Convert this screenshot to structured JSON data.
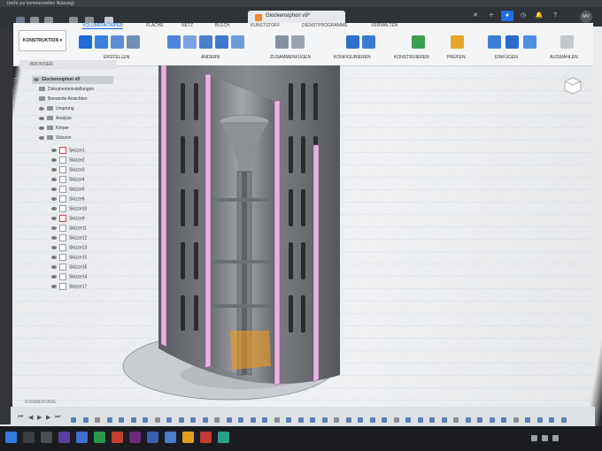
{
  "title_bar": {
    "text": "(nicht zur kommerziellen Nutzung)"
  },
  "document": {
    "name": "Glockensiphon v9*"
  },
  "user": {
    "initials": "MV"
  },
  "ribbon": {
    "mode": "KONSTRUKTION",
    "tabs": [
      "VOLUMENKÖRPER",
      "FLÄCHE",
      "NETZ",
      "BLECH",
      "KUNSTSTOFF",
      "DIENSTPROGRAMME",
      "VERWALTEN"
    ],
    "groups": [
      "ERSTELLEN",
      "ÄNDERN",
      "ZUSAMMENFÜGEN",
      "KONFIGURIEREN",
      "KONSTRUIEREN",
      "PRÜFEN",
      "EINFÜGEN",
      "AUSWÄHLEN"
    ]
  },
  "browser": {
    "header": "BROWSER",
    "root": "Glockensiphon v9",
    "items": [
      "Dokumenteinstellungen",
      "Benannte Ansichten",
      "Ursprung",
      "Analyse",
      "Körper",
      "Skizzen"
    ],
    "sketches": [
      "Skizze1",
      "Skizze2",
      "Skizze3",
      "Skizze4",
      "Skizze5",
      "Skizze6",
      "Skizze10",
      "Skizze9",
      "Skizze11",
      "Skizze12",
      "Skizze13",
      "Skizze15",
      "Skizze16",
      "Skizze14",
      "Skizze17"
    ]
  },
  "comments": {
    "label": "KOMMENTARE"
  },
  "colors": {
    "accent": "#0a6ad6",
    "section": "#e6b4e0",
    "highlight": "#f29a1c",
    "body": "#7d8085"
  }
}
